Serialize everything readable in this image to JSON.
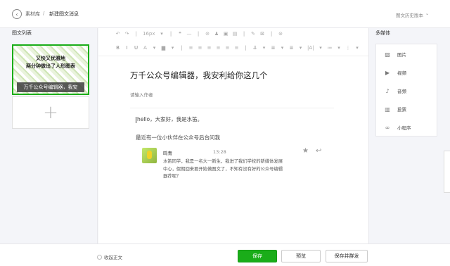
{
  "header": {
    "back_icon": "back-arrow-icon",
    "breadcrumb_root": "素材库",
    "breadcrumb_sep": "/",
    "breadcrumb_current": "新建图文消息",
    "history_label": "图文历史版本",
    "history_caret": "⌄"
  },
  "left_panel": {
    "title": "图文列表",
    "article": {
      "cover_line1": "又快又优雅地",
      "cover_line2": "两分钟做出了人形图表",
      "caption": "万千公众号编辑器，我安"
    },
    "add_symbol": "+"
  },
  "toolbar": {
    "row1": [
      "↶",
      "↷",
      "|",
      "16px",
      "▾",
      "|",
      "❝",
      "—",
      "|",
      "⊘",
      "♟",
      "▣",
      "▤",
      "|",
      "✎",
      "⊠",
      "|",
      "⊜"
    ],
    "row2": [
      "B",
      "I",
      "U",
      "A",
      "▾",
      "▆",
      "▾",
      "|",
      "≡",
      "≡",
      "≡",
      "≡",
      "≡",
      "≡",
      "|",
      "⇊",
      "▾",
      "≣",
      "▾",
      "≣",
      "▾",
      "|A|",
      "▾",
      "≔",
      "▾",
      "⋮",
      "▾"
    ]
  },
  "article": {
    "title": "万千公众号编辑器，我安利给你这几个",
    "author_placeholder": "请输入作者",
    "body_line1": "hello，大家好，我是水笛。",
    "body_line2": "最近有一位小伙伴在公众号后台问我"
  },
  "comment": {
    "name": "鸣青",
    "time": "13:28",
    "text": "水笛同学，我是一名大一新生，我进了我们学校的新媒体发展中心，假期回来要开始做图文了，不知有没有好的公众号编辑器荐呢？",
    "star_icon": "★",
    "reply_icon": "↩"
  },
  "media": {
    "title": "多媒体",
    "items": [
      {
        "icon": "▨",
        "label": "图片"
      },
      {
        "icon": "▶",
        "label": "视频"
      },
      {
        "icon": "♪",
        "label": "音频"
      },
      {
        "icon": "▥",
        "label": "投票"
      },
      {
        "icon": "∞",
        "label": "小程序"
      }
    ]
  },
  "footer": {
    "collapse_label": "收起正文",
    "save_label": "保存",
    "preview_label": "预览",
    "publish_label": "保存并群发"
  },
  "colors": {
    "accent": "#1aad19",
    "background": "#f4f5f9"
  }
}
